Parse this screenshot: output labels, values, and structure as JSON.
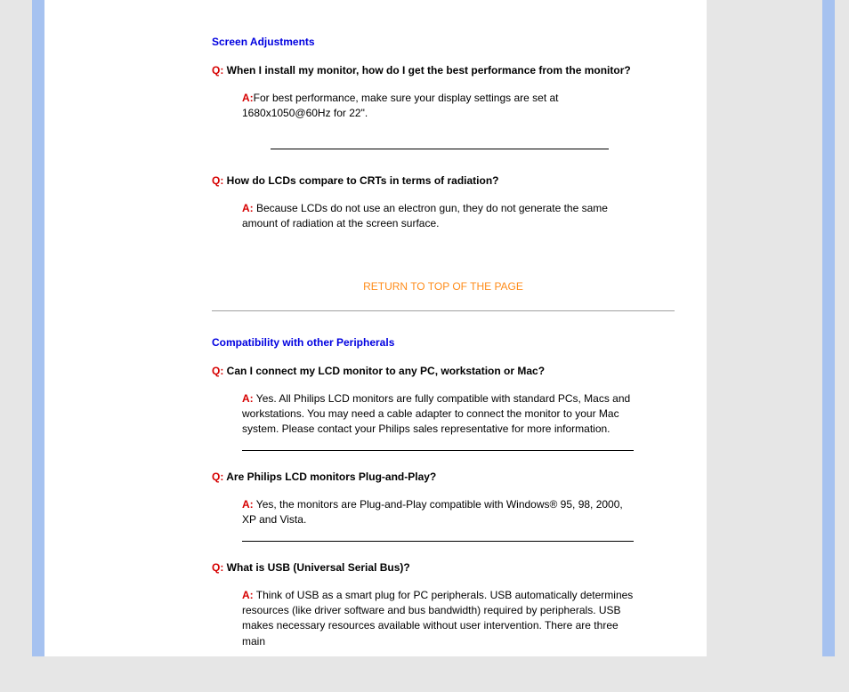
{
  "sections": {
    "screen_adjustments": {
      "heading": "Screen Adjustments",
      "q1": {
        "q_label": "Q:",
        "q_text": " When I install my monitor, how do I get the best performance from the monitor?",
        "a_label": "A:",
        "a_text": "For best performance, make sure your display settings are set at 1680x1050@60Hz for 22\"."
      },
      "q2": {
        "q_label": "Q:",
        "q_text": " How do LCDs compare to CRTs in terms of radiation?",
        "a_label": "A:",
        "a_text": " Because LCDs do not use an electron gun, they do not generate the same amount of radiation at the screen surface."
      }
    },
    "compatibility": {
      "heading": "Compatibility with other Peripherals",
      "q1": {
        "q_label": "Q:",
        "q_text": " Can I connect my LCD monitor to any PC, workstation or Mac?",
        "a_label": "A:",
        "a_text": " Yes. All Philips LCD monitors are fully compatible with standard PCs, Macs and workstations. You may need a cable adapter to connect the monitor to your Mac system. Please contact your Philips sales representative for more information."
      },
      "q2": {
        "q_label": "Q:",
        "q_text": " Are Philips LCD monitors Plug-and-Play?",
        "a_label": "A:",
        "a_text": " Yes, the monitors are Plug-and-Play compatible with Windows® 95, 98, 2000, XP and Vista."
      },
      "q3": {
        "q_label": "Q:",
        "q_text": " What is USB (Universal Serial Bus)?",
        "a_label": "A:",
        "a_text": " Think of USB as a smart plug for PC peripherals. USB automatically determines resources (like driver software and bus bandwidth) required by peripherals. USB makes necessary resources available without user intervention. There are three main"
      }
    }
  },
  "top_link": "RETURN TO TOP OF THE PAGE"
}
